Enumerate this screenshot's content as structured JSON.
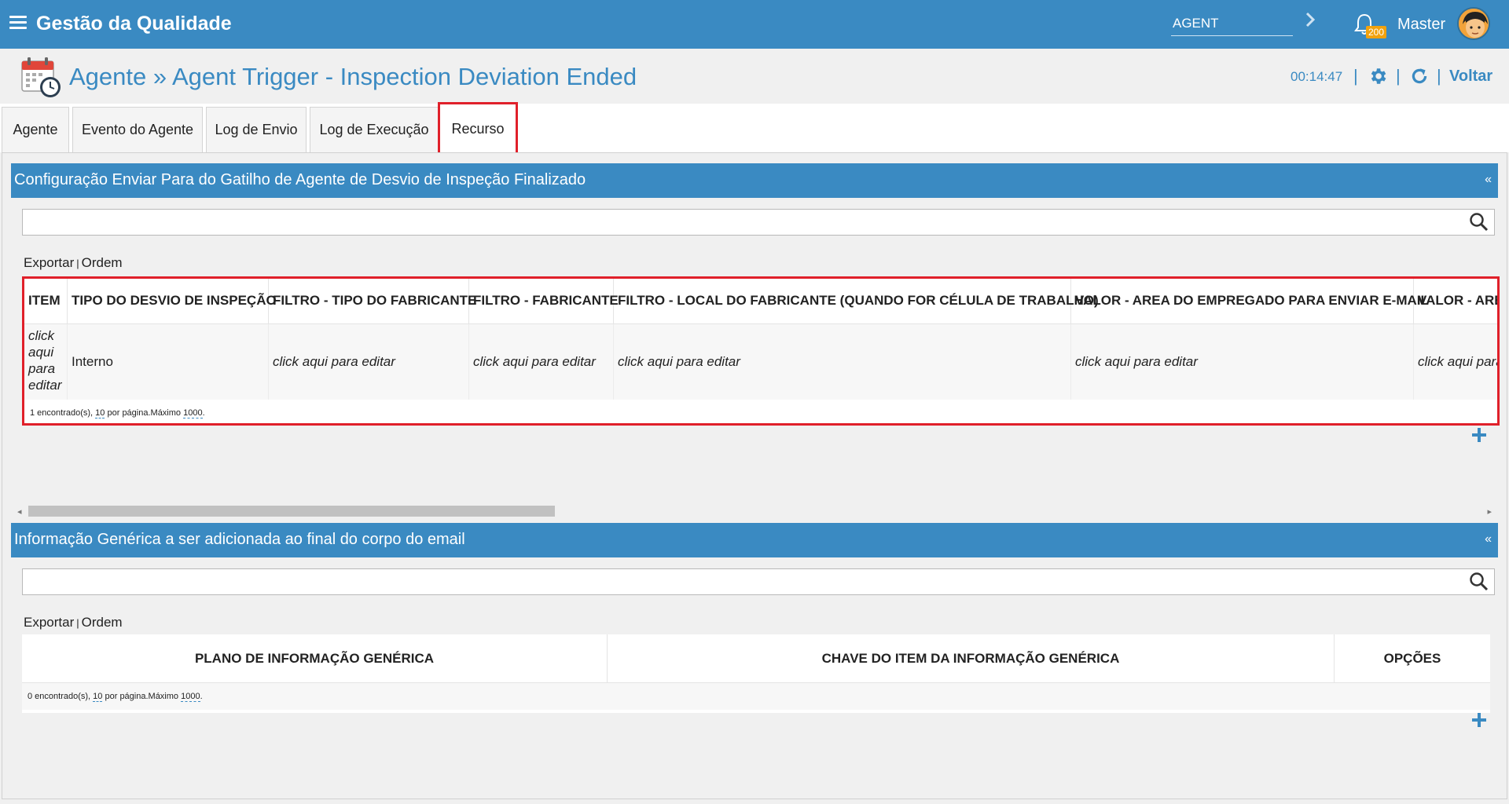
{
  "topbar": {
    "app_title": "Gestão da Qualidade",
    "module_value": "AGENT",
    "notification_count": "200",
    "user_name": "Master"
  },
  "header": {
    "title": "Agente » Agent Trigger - Inspection Deviation Ended",
    "timer": "00:14:47",
    "back_label": "Voltar"
  },
  "tabs": [
    {
      "label": "Agente"
    },
    {
      "label": "Evento do Agente"
    },
    {
      "label": "Log de Envio"
    },
    {
      "label": "Log de Execução"
    },
    {
      "label": "Recurso"
    }
  ],
  "section1": {
    "title": "Configuração Enviar Para do Gatilho de Agente de Desvio de Inspeção Finalizado",
    "collapse_symbol": "«",
    "search_value": "",
    "export_label": "Exportar",
    "sep": "|",
    "order_label": "Ordem",
    "columns": [
      "ITEM",
      "TIPO DO DESVIO DE INSPEÇÃO",
      "FILTRO - TIPO DO FABRICANTE",
      "FILTRO - FABRICANTE",
      "FILTRO - LOCAL DO FABRICANTE (QUANDO FOR CÉLULA DE TRABALHO)",
      "VALOR - AREA DO EMPREGADO PARA ENVIAR E-MAIL",
      "VALOR - ARE"
    ],
    "rows": [
      {
        "item": "click aqui para editar",
        "tipo": "Interno",
        "filtro_tipo_fabricante": "click aqui para editar",
        "filtro_fabricante": "click aqui para editar",
        "filtro_local": "click aqui para editar",
        "valor_area": "click aqui para editar",
        "valor_are": "click aqui para"
      }
    ],
    "pager": {
      "found_text": "1 encontrado(s),",
      "per_page": "10",
      "per_page_text": "por página.Máximo",
      "max": "1000",
      "end": "."
    }
  },
  "section2": {
    "title": "Informação Genérica a ser adicionada ao final do corpo do email",
    "collapse_symbol": "«",
    "search_value": "",
    "export_label": "Exportar",
    "sep": "|",
    "order_label": "Ordem",
    "columns": [
      "PLANO DE INFORMAÇÃO GENÉRICA",
      "CHAVE DO ITEM DA INFORMAÇÃO GENÉRICA",
      "OPÇÕES"
    ],
    "pager": {
      "found_text": "0 encontrado(s),",
      "per_page": "10",
      "per_page_text": "por página.Máximo",
      "max": "1000",
      "end": "."
    }
  },
  "colors": {
    "primary": "#3a8ac2",
    "highlight": "#e0202a",
    "badge": "#f2a20e"
  }
}
